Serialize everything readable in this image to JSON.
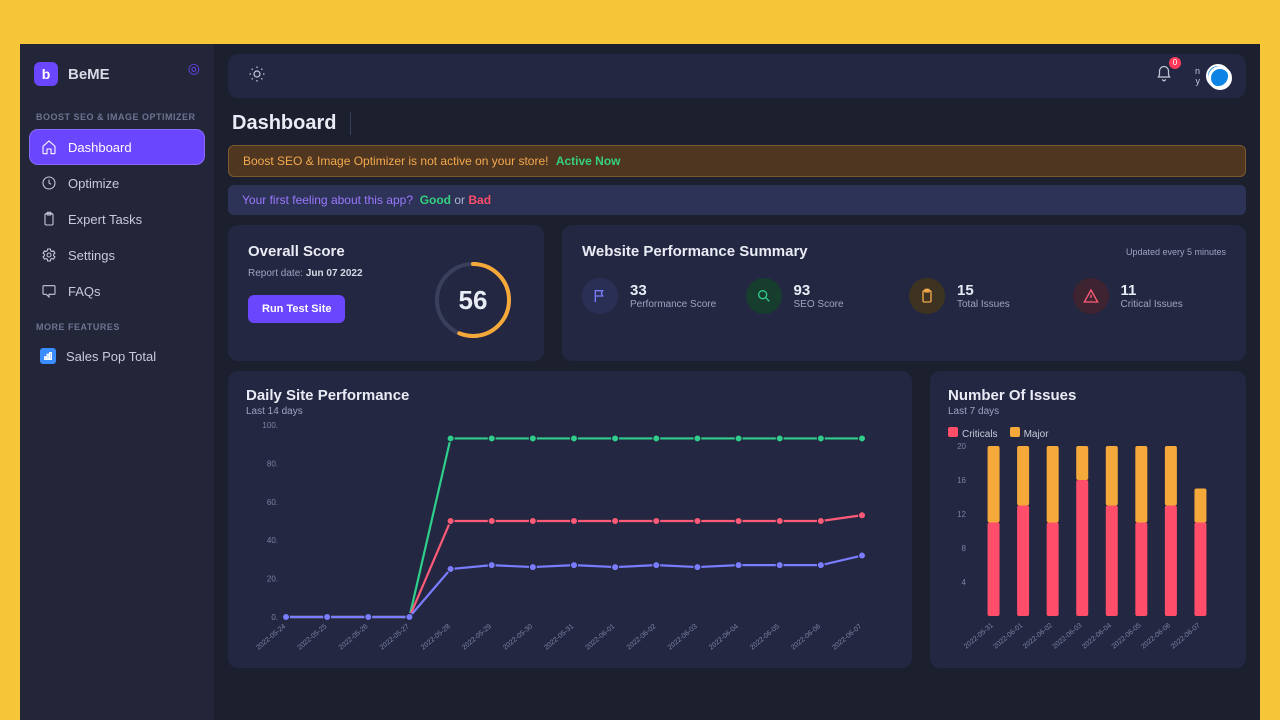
{
  "brand": {
    "name": "BeME"
  },
  "sidebar": {
    "section1_label": "BOOST SEO & IMAGE OPTIMIZER",
    "section2_label": "MORE FEATURES",
    "items": [
      {
        "label": "Dashboard"
      },
      {
        "label": "Optimize"
      },
      {
        "label": "Expert Tasks"
      },
      {
        "label": "Settings"
      },
      {
        "label": "FAQs"
      }
    ],
    "more": [
      {
        "label": "Sales Pop Total"
      }
    ]
  },
  "topbar": {
    "notif_count": "0",
    "user_short": "n\ny"
  },
  "page": {
    "title": "Dashboard"
  },
  "banners": {
    "warn_text": "Boost SEO & Image Optimizer is not active on your store!",
    "warn_action": "Active Now",
    "feel_text": "Your first feeling about this app?",
    "good": "Good",
    "or": "or",
    "bad": "Bad"
  },
  "overall": {
    "title": "Overall Score",
    "report_label": "Report date:",
    "report_date": "Jun 07 2022",
    "run_btn": "Run Test Site",
    "score": "56"
  },
  "wps": {
    "title": "Website Performance Summary",
    "updated": "Updated every 5 minutes",
    "stats": [
      {
        "val": "33",
        "lbl": "Performance Score"
      },
      {
        "val": "93",
        "lbl": "SEO Score"
      },
      {
        "val": "15",
        "lbl": "Total Issues"
      },
      {
        "val": "11",
        "lbl": "Critical Issues"
      }
    ]
  },
  "perf_chart": {
    "title": "Daily Site Performance",
    "sub": "Last 14 days"
  },
  "issues_chart": {
    "title": "Number Of Issues",
    "sub": "Last 7 days",
    "legend": {
      "crit": "Criticals",
      "major": "Major"
    }
  },
  "chart_data": [
    {
      "type": "line",
      "title": "Daily Site Performance",
      "ylabel": "",
      "xlabel": "",
      "ylim": [
        0,
        100
      ],
      "yticks": [
        0,
        20,
        40,
        60,
        80,
        100
      ],
      "categories": [
        "2022-05-24",
        "2022-05-25",
        "2022-05-26",
        "2022-05-27",
        "2022-05-28",
        "2022-05-29",
        "2022-05-30",
        "2022-05-31",
        "2022-06-01",
        "2022-06-02",
        "2022-06-03",
        "2022-06-04",
        "2022-06-05",
        "2022-06-06",
        "2022-06-07"
      ],
      "series": [
        {
          "name": "green",
          "color": "#2fce8b",
          "values": [
            0,
            0,
            0,
            0,
            93,
            93,
            93,
            93,
            93,
            93,
            93,
            93,
            93,
            93,
            93
          ]
        },
        {
          "name": "red",
          "color": "#ff5b78",
          "values": [
            0,
            0,
            0,
            0,
            50,
            50,
            50,
            50,
            50,
            50,
            50,
            50,
            50,
            50,
            53
          ]
        },
        {
          "name": "purple",
          "color": "#7a7dff",
          "values": [
            0,
            0,
            0,
            0,
            25,
            27,
            26,
            27,
            26,
            27,
            26,
            27,
            27,
            27,
            32
          ]
        }
      ]
    },
    {
      "type": "bar",
      "title": "Number Of Issues",
      "ylim": [
        0,
        20
      ],
      "yticks": [
        4,
        8,
        12,
        16,
        20
      ],
      "categories": [
        "2022-05-31",
        "2022-06-01",
        "2022-06-02",
        "2022-06-03",
        "2022-06-04",
        "2022-06-05",
        "2022-06-06",
        "2022-06-07"
      ],
      "series": [
        {
          "name": "Criticals",
          "color": "#ff4d6a",
          "values": [
            11,
            13,
            11,
            16,
            13,
            11,
            13,
            11
          ]
        },
        {
          "name": "Major",
          "color": "#f6a93b",
          "values": [
            9,
            7,
            9,
            4,
            7,
            9,
            7,
            4
          ]
        }
      ]
    }
  ]
}
